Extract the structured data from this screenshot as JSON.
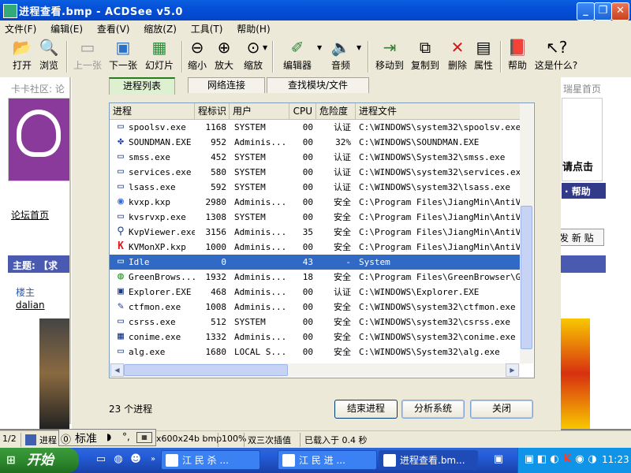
{
  "window": {
    "title": "进程查看.bmp - ACDSee v5.0",
    "minimize": "_",
    "restore": "❐",
    "close": "✕"
  },
  "menu": [
    "文件(F)",
    "编辑(E)",
    "查看(V)",
    "缩放(Z)",
    "工具(T)",
    "帮助(H)"
  ],
  "toolbar": {
    "open": "打开",
    "browse": "浏览",
    "prev": "上一张",
    "next": "下一张",
    "slideshow": "幻灯片",
    "zoom_out": "缩小",
    "zoom_in": "放大",
    "zoom": "缩放",
    "editor": "编辑器",
    "audio": "音频",
    "move_to": "移动到",
    "copy_to": "复制到",
    "delete": "删除",
    "properties": "属性",
    "help": "帮助",
    "whats_this": "这是什么?"
  },
  "background_page": {
    "community": "卡卡社区: 论",
    "star_home": "瑞星首页",
    "forum_home": "论坛首页",
    "click_here": "请点击",
    "help_link": "· 帮助",
    "new_post": "发 新 贴",
    "topic": "主题: 【求",
    "owner": "楼主",
    "user": "dalian"
  },
  "dialog": {
    "tabs": [
      "进程列表",
      "网络连接",
      "查找模块/文件"
    ],
    "columns": [
      "进程",
      "程标识",
      "用户",
      "CPU",
      "危险度",
      "进程文件"
    ],
    "rows": [
      {
        "name": "spoolsv.exe",
        "pid": "1168",
        "user": "SYSTEM",
        "cpu": "00",
        "risk": "认证",
        "path": "C:\\WINDOWS\\system32\\spoolsv.exe",
        "icon": "▭"
      },
      {
        "name": "SOUNDMAN.EXE",
        "pid": "952",
        "user": "Adminis...",
        "cpu": "00",
        "risk": "32%",
        "path": "C:\\WINDOWS\\SOUNDMAN.EXE",
        "icon": "✤"
      },
      {
        "name": "smss.exe",
        "pid": "452",
        "user": "SYSTEM",
        "cpu": "00",
        "risk": "认证",
        "path": "C:\\WINDOWS\\System32\\smss.exe",
        "icon": "▭"
      },
      {
        "name": "services.exe",
        "pid": "580",
        "user": "SYSTEM",
        "cpu": "00",
        "risk": "认证",
        "path": "C:\\WINDOWS\\system32\\services.exe",
        "icon": "▭"
      },
      {
        "name": "lsass.exe",
        "pid": "592",
        "user": "SYSTEM",
        "cpu": "00",
        "risk": "认证",
        "path": "C:\\WINDOWS\\system32\\lsass.exe",
        "icon": "▭"
      },
      {
        "name": "kvxp.kxp",
        "pid": "2980",
        "user": "Adminis...",
        "cpu": "00",
        "risk": "安全",
        "path": "C:\\Program Files\\JiangMin\\AntiViru",
        "icon": "◉"
      },
      {
        "name": "kvsrvxp.exe",
        "pid": "1308",
        "user": "SYSTEM",
        "cpu": "00",
        "risk": "安全",
        "path": "C:\\Program Files\\JiangMin\\AntiViru",
        "icon": "▭"
      },
      {
        "name": "KvpViewer.exe",
        "pid": "3156",
        "user": "Adminis...",
        "cpu": "35",
        "risk": "安全",
        "path": "C:\\Program Files\\JiangMin\\AntiViru",
        "icon": "⚲"
      },
      {
        "name": "KVMonXP.kxp",
        "pid": "1000",
        "user": "Adminis...",
        "cpu": "00",
        "risk": "安全",
        "path": "C:\\Program Files\\JiangMin\\AntiViru",
        "icon": "K"
      },
      {
        "name": "Idle",
        "pid": "0",
        "user": "",
        "cpu": "43",
        "risk": "-",
        "path": "System",
        "icon": "▭"
      },
      {
        "name": "GreenBrows...",
        "pid": "1932",
        "user": "Adminis...",
        "cpu": "18",
        "risk": "安全",
        "path": "C:\\Program Files\\GreenBrowser\\Gree",
        "icon": "◍"
      },
      {
        "name": "Explorer.EXE",
        "pid": "468",
        "user": "Adminis...",
        "cpu": "00",
        "risk": "认证",
        "path": "C:\\WINDOWS\\Explorer.EXE",
        "icon": "▣"
      },
      {
        "name": "ctfmon.exe",
        "pid": "1008",
        "user": "Adminis...",
        "cpu": "00",
        "risk": "安全",
        "path": "C:\\WINDOWS\\system32\\ctfmon.exe",
        "icon": "✎"
      },
      {
        "name": "csrss.exe",
        "pid": "512",
        "user": "SYSTEM",
        "cpu": "00",
        "risk": "安全",
        "path": "C:\\WINDOWS\\system32\\csrss.exe",
        "icon": "▭"
      },
      {
        "name": "conime.exe",
        "pid": "1332",
        "user": "Adminis...",
        "cpu": "00",
        "risk": "安全",
        "path": "C:\\WINDOWS\\system32\\conime.exe",
        "icon": "▦"
      },
      {
        "name": "alg.exe",
        "pid": "1680",
        "user": "LOCAL S...",
        "cpu": "00",
        "risk": "安全",
        "path": "C:\\WINDOWS\\System32\\alg.exe",
        "icon": "▭"
      }
    ],
    "count": "23 个进程",
    "end_process": "结束进程",
    "analyze": "分析系统",
    "close": "关闭"
  },
  "statusbar": {
    "page": "1/2",
    "process": "进程",
    "dims": "x600x24b bmp",
    "zoom": "100%",
    "interp": "双三次插值",
    "loaded": "已载入于 0.4 秒"
  },
  "ime": {
    "mode": "标准"
  },
  "taskbar": {
    "start": "开始",
    "tasks": [
      "江 民 杀 ...",
      "江 民 进 ...",
      "进程查看.bm..."
    ],
    "clock": "11:23"
  }
}
